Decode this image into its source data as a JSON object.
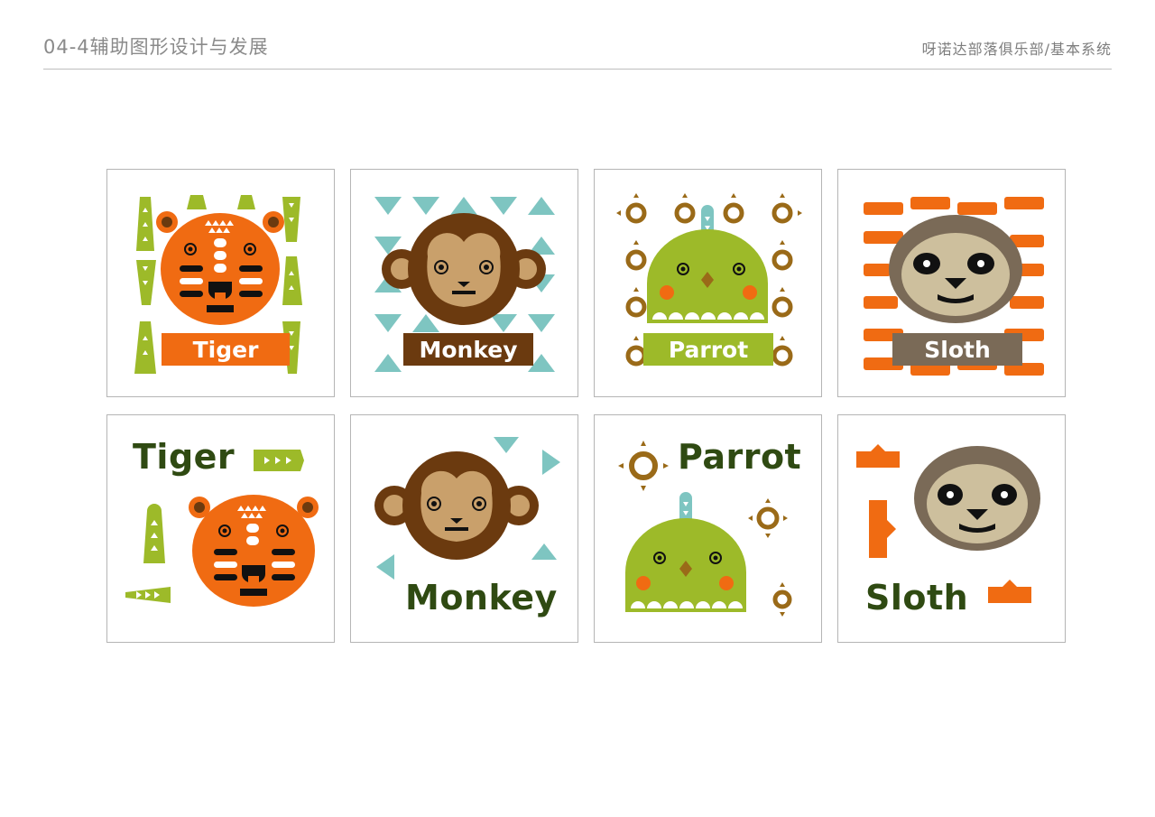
{
  "header": {
    "title": "04-4辅助图形设计与发展",
    "subtitle": "呀诺达部落俱乐部/基本系统"
  },
  "colors": {
    "tiger": "#f06b12",
    "green": "#9dba29",
    "monkey_dark": "#6b3a0f",
    "monkey_face": "#c9a06b",
    "teal": "#7ec5c1",
    "parrot_green": "#9dba29",
    "sun_brown": "#9a6a18",
    "sloth_gray": "#7a6a57",
    "sloth_face": "#cdbf9d",
    "label_dark_green": "#2f4a12"
  },
  "pattern_row": {
    "tiger": {
      "label": "Tiger"
    },
    "monkey": {
      "label": "Monkey"
    },
    "parrot": {
      "label": "Parrot"
    },
    "sloth": {
      "label": "Sloth"
    }
  },
  "emblem_row": {
    "tiger": {
      "label": "Tiger"
    },
    "monkey": {
      "label": "Monkey"
    },
    "parrot": {
      "label": "Parrot"
    },
    "sloth": {
      "label": "Sloth"
    }
  }
}
